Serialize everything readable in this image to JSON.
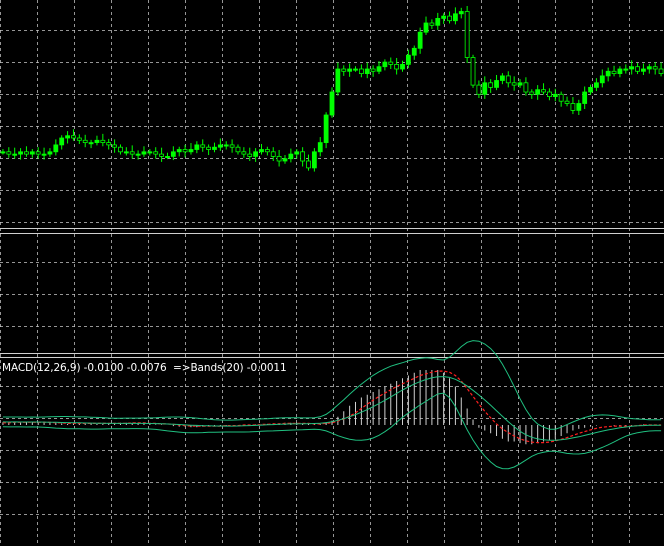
{
  "indicator": {
    "label": "MACD(12,26,9) -0.0100 -0.0076  =>Bands(20) -0.0011"
  },
  "colors": {
    "background": "#000000",
    "grid": "#c8c8c8",
    "separator": "#d0d0d0",
    "bull_candle": "#00ff00",
    "bear_candle": "#000000",
    "candle_outline": "#00ff00",
    "histogram": "#d0d0d0",
    "signal_line": "#ff2020",
    "bands": "#20c080"
  },
  "chart_data": [
    {
      "type": "candlestick",
      "title": "",
      "description_values": "close levels relative (0 = top of visible range, 1 = bottom)",
      "closes": [
        0.66,
        0.67,
        0.67,
        0.66,
        0.67,
        0.66,
        0.67,
        0.67,
        0.66,
        0.63,
        0.6,
        0.59,
        0.6,
        0.61,
        0.62,
        0.62,
        0.61,
        0.62,
        0.63,
        0.64,
        0.66,
        0.66,
        0.67,
        0.67,
        0.66,
        0.66,
        0.67,
        0.68,
        0.68,
        0.66,
        0.65,
        0.66,
        0.65,
        0.63,
        0.64,
        0.65,
        0.64,
        0.63,
        0.63,
        0.64,
        0.66,
        0.67,
        0.68,
        0.66,
        0.65,
        0.66,
        0.68,
        0.7,
        0.69,
        0.67,
        0.66,
        0.7,
        0.73,
        0.66,
        0.62,
        0.5,
        0.4,
        0.3,
        0.31,
        0.3,
        0.3,
        0.32,
        0.3,
        0.31,
        0.29,
        0.27,
        0.28,
        0.3,
        0.28,
        0.24,
        0.21,
        0.14,
        0.1,
        0.11,
        0.08,
        0.07,
        0.09,
        0.06,
        0.05,
        0.25,
        0.37,
        0.41,
        0.36,
        0.38,
        0.35,
        0.33,
        0.36,
        0.37,
        0.36,
        0.4,
        0.41,
        0.39,
        0.4,
        0.42,
        0.41,
        0.44,
        0.45,
        0.48,
        0.45,
        0.4,
        0.38,
        0.36,
        0.33,
        0.31,
        0.32,
        0.3,
        0.3,
        0.29,
        0.31,
        0.3,
        0.29,
        0.3,
        0.32
      ],
      "ylim": [
        0,
        1
      ]
    },
    {
      "type": "bar",
      "title": "MACD(12,26,9) -0.0100 -0.0076  =>Bands(20) -0.0011",
      "series": [
        {
          "name": "MACD",
          "values": [
            0.05,
            0.06,
            0.06,
            0.05,
            0.06,
            0.05,
            0.05,
            0.06,
            0.05,
            0.04,
            0.03,
            0.02,
            0.02,
            0.02,
            0.03,
            0.03,
            0.02,
            0.02,
            0.03,
            0.03,
            0.04,
            0.04,
            0.04,
            0.04,
            0.03,
            0.02,
            0.01,
            0.01,
            0.0,
            -0.02,
            -0.03,
            -0.03,
            -0.04,
            -0.04,
            -0.03,
            -0.02,
            -0.02,
            -0.01,
            -0.01,
            0.0,
            0.0,
            0.0,
            0.0,
            0.01,
            0.01,
            0.02,
            0.03,
            0.03,
            0.04,
            0.04,
            0.04,
            0.03,
            0.02,
            0.01,
            0.02,
            0.05,
            0.08,
            0.15,
            0.25,
            0.35,
            0.42,
            0.5,
            0.55,
            0.6,
            0.65,
            0.7,
            0.75,
            0.8,
            0.85,
            0.9,
            0.95,
            1.0,
            1.0,
            1.0,
            1.0,
            0.95,
            0.85,
            0.7,
            0.5,
            0.3,
            0.1,
            -0.05,
            -0.1,
            -0.15,
            -0.2,
            -0.25,
            -0.3,
            -0.3,
            -0.33,
            -0.35,
            -0.35,
            -0.33,
            -0.3,
            -0.28,
            -0.25,
            -0.2,
            -0.15,
            -0.1,
            -0.07,
            -0.05,
            -0.03,
            -0.01,
            0.0,
            0.0,
            -0.01,
            -0.02,
            -0.02,
            -0.01,
            0.0,
            0.01,
            0.01,
            0.0,
            0.0
          ]
        },
        {
          "name": "Signal",
          "values": [
            0.04,
            0.04,
            0.05,
            0.05,
            0.05,
            0.05,
            0.05,
            0.05,
            0.05,
            0.04,
            0.04,
            0.03,
            0.03,
            0.03,
            0.03,
            0.03,
            0.03,
            0.03,
            0.03,
            0.03,
            0.03,
            0.03,
            0.04,
            0.04,
            0.04,
            0.03,
            0.03,
            0.02,
            0.02,
            0.01,
            0.0,
            -0.01,
            -0.02,
            -0.02,
            -0.02,
            -0.02,
            -0.02,
            -0.02,
            -0.01,
            -0.01,
            -0.01,
            0.0,
            0.0,
            0.0,
            0.01,
            0.01,
            0.02,
            0.02,
            0.03,
            0.03,
            0.03,
            0.03,
            0.03,
            0.02,
            0.02,
            0.03,
            0.04,
            0.07,
            0.11,
            0.16,
            0.22,
            0.3,
            0.38,
            0.45,
            0.52,
            0.58,
            0.64,
            0.7,
            0.75,
            0.8,
            0.85,
            0.9,
            0.93,
            0.96,
            0.98,
            0.98,
            0.96,
            0.9,
            0.8,
            0.66,
            0.52,
            0.38,
            0.25,
            0.13,
            0.02,
            -0.07,
            -0.14,
            -0.2,
            -0.25,
            -0.29,
            -0.31,
            -0.32,
            -0.32,
            -0.31,
            -0.29,
            -0.26,
            -0.23,
            -0.19,
            -0.15,
            -0.12,
            -0.09,
            -0.06,
            -0.04,
            -0.03,
            -0.02,
            -0.02,
            -0.02,
            -0.02,
            -0.01,
            0.0,
            0.0,
            0.0,
            0.0
          ]
        }
      ],
      "ylim": [
        -1,
        1.3
      ]
    }
  ]
}
